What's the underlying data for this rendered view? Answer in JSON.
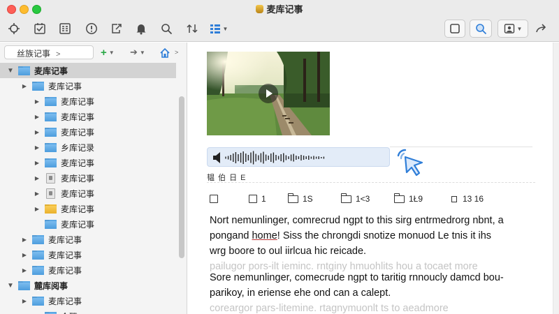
{
  "window": {
    "title": "麦库记事"
  },
  "toolbar": {
    "left_icons": [
      "target-icon",
      "checkmark-icon",
      "list-icon",
      "info-icon",
      "share-icon",
      "bell-icon",
      "search-icon",
      "sync-icon",
      "view-icon"
    ],
    "right_icons": [
      "square-icon",
      "magnifier-icon",
      "contact-icon",
      "forward-icon"
    ]
  },
  "sidebar": {
    "crumb": "丝族记事",
    "tree": [
      {
        "label": "麦库记事",
        "icon": "folder-blue",
        "level": 0,
        "expanded": true,
        "selected": true
      },
      {
        "label": "麦库记事",
        "icon": "folder-blue",
        "level": 1
      },
      {
        "label": "麦库记事",
        "icon": "folder-blue",
        "level": 2
      },
      {
        "label": "麦库记事",
        "icon": "folder-blue",
        "level": 2
      },
      {
        "label": "麦库记事",
        "icon": "folder-blue",
        "level": 2
      },
      {
        "label": "乡库记录",
        "icon": "folder-blue",
        "level": 2
      },
      {
        "label": "麦库记事",
        "icon": "folder-blue",
        "level": 2
      },
      {
        "label": "麦库记事",
        "icon": "note",
        "level": 2
      },
      {
        "label": "麦库记事",
        "icon": "note",
        "level": 2
      },
      {
        "label": "麦库记事",
        "icon": "folder-yellow",
        "level": 2
      },
      {
        "label": "麦库记事",
        "icon": "folder-blue",
        "level": 2,
        "no_disclosure": true
      },
      {
        "label": "麦库记事",
        "icon": "folder-blue",
        "level": 1
      },
      {
        "label": "麦库记事",
        "icon": "folder-blue",
        "level": 1
      },
      {
        "label": "麦库记事",
        "icon": "folder-blue",
        "level": 1
      },
      {
        "label": "麓库阅事",
        "icon": "folder-blue",
        "level": 0,
        "expanded": true
      },
      {
        "label": "麦库记事",
        "icon": "folder-blue",
        "level": 1
      },
      {
        "label": "众碟",
        "icon": "folder-blue",
        "level": 2,
        "no_disclosure": true
      }
    ]
  },
  "note": {
    "info_line": "韫 伯 日 E",
    "meta": [
      {
        "icon": "checkbox-icon",
        "text": ""
      },
      {
        "icon": "checkbox-icon",
        "text": "1"
      },
      {
        "icon": "folder-outline-icon",
        "text": "1S"
      },
      {
        "icon": "folder-outline-icon",
        "text": "1<3"
      },
      {
        "icon": "folder-outline-icon",
        "text": "1Ł9"
      },
      {
        "icon": "small-square-icon",
        "text": "13 16"
      }
    ],
    "paragraph1": {
      "line1": "Nort nemunlinger, comrecrud ngpt to this sirg entrmedrorg nbnt, a",
      "line2_before": "pongand ",
      "line2_underlined": "home",
      "line2_after": "! Siss the chrongdi snotize monuod Le tnis it ihs",
      "line3": "wrg boore to oul iirlcua hic reicade.",
      "line4": "pailugor pors-ilt ieminc. rntginy hmuohlits hou a tocaet more"
    },
    "paragraph2": {
      "line1": "Sore nemunlinger, comecrude ngpt to taritig rnnoucly damcd bou-",
      "line2": "parikoy, in eriense ehe ond can a calept.",
      "line3": "coreargor pars-litemine. rtagnymuonlt ts to aeadmore"
    }
  }
}
